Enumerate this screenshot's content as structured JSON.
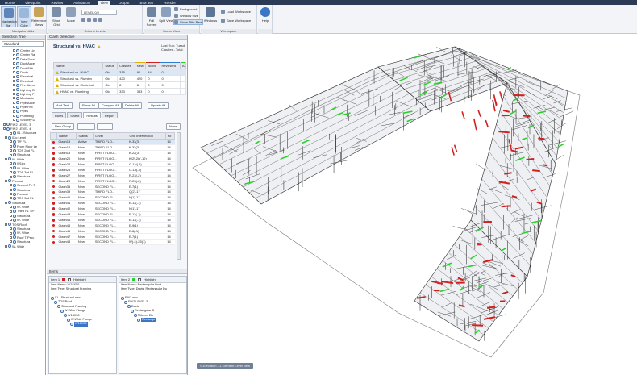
{
  "menu": [
    "Home",
    "Viewpoint",
    "Review",
    "Animation",
    "View",
    "Output",
    "BIM 360",
    "Render"
  ],
  "menu_active": "View",
  "ribbon": {
    "groups": [
      "Navigation Aids",
      "Grids & Levels",
      "Scene View",
      "Workspace"
    ],
    "buttons": {
      "navigation_bar": "Navigation Bar",
      "view_cube": "View Cube",
      "reference_views": "Reference Views",
      "show_grid": "Show Grid",
      "mode": "Mode",
      "full_screen": "Full Screen",
      "split_view": "Split View",
      "windows": "Windows",
      "help": "Help"
    },
    "grid_combo": "LEVEL 0/0",
    "scene_small": [
      "Background",
      "Window Size",
      "Show Title Bars"
    ],
    "workspace_small": [
      "Load Workspace",
      "Save Workspace"
    ]
  },
  "selection_tree": {
    "title": "Selection Tree",
    "combo": "Standard",
    "nodes": [
      "Center Lin",
      "Center Ra",
      "Data Devi",
      "Duct Acce",
      "Duct Fitti",
      "Ducts",
      "Electrical",
      "Electrical",
      "Fire Alarm",
      "Lighting D",
      "Lighting F",
      "Mechanic",
      "Pipe Acce",
      "Pipe Fitti",
      "Pipes",
      "Plumbing",
      "Security D",
      "FIN2 LEVEL 3",
      "FIN2 LEVEL 4",
      "01 - Structura",
      "03c Level",
      "T/F FL",
      "From Floor Le",
      "TOS 2nd FL",
      "Structura",
      "W- Wide",
      "W18x",
      "W- Wide",
      "TOS 3rd FL",
      "Structura",
      "Precast",
      "Second FL T",
      "Structura",
      "Precast",
      "TOS 3rd FL",
      "Structura",
      "W- Wide",
      "Third FL T/F",
      "Structura",
      "W- Wide",
      "TOS Roof",
      "Structura",
      "W- Wide",
      "Roof T/Proc",
      "Structura",
      "W- Wide"
    ]
  },
  "clash": {
    "panel_title": "Clash Detective",
    "test_name": "Structural vs. HVAC",
    "last_run": "Last Run: Tuesd",
    "clashes_total": "Clashes - Total:",
    "tests_headers": [
      "Name",
      "Status",
      "Clashes",
      "New",
      "Active",
      "Reviewed",
      "A"
    ],
    "tests": [
      {
        "name": "Structural vs. HVAC",
        "status": "Old",
        "clashes": "315",
        "new": "90",
        "active": "44",
        "reviewed": "0"
      },
      {
        "name": "Structural vs. Plumbin",
        "status": "Old",
        "clashes": "420",
        "new": "420",
        "active": "0",
        "reviewed": "0"
      },
      {
        "name": "Structural vs. Electrical",
        "status": "Old",
        "clashes": "8",
        "new": "8",
        "active": "0",
        "reviewed": "0"
      },
      {
        "name": "HVAC vs. Plumbing",
        "status": "Old",
        "clashes": "333",
        "new": "333",
        "active": "0",
        "reviewed": "0"
      }
    ],
    "buttons": {
      "add_test": "Add Test",
      "reset_all": "Reset All",
      "compact_all": "Compact All",
      "delete_all": "Delete All",
      "update_all": "Update All"
    },
    "tabs": [
      "Rules",
      "Select",
      "Results",
      "Report"
    ],
    "active_tab": "Results",
    "new_group": "New Group",
    "none_combo": "None",
    "results_headers": [
      "Name",
      "Status",
      "Level",
      "Grid Intersection",
      "Fo"
    ],
    "results": [
      {
        "name": "Clash15",
        "status": "Active",
        "level": "THIRD FLO...",
        "grid": "K-33(3)",
        "found": "14"
      },
      {
        "name": "Clash16",
        "status": "New",
        "level": "THIRD FLO...",
        "grid": "K-33(3)",
        "found": "14"
      },
      {
        "name": "Clash18",
        "status": "New",
        "level": "FIRST FLOO...",
        "grid": "K-22(3)",
        "found": "14"
      },
      {
        "name": "Clash20",
        "status": "New",
        "level": "FIRST FLOO...",
        "grid": "K(2)-26(-10)",
        "found": "14"
      },
      {
        "name": "Clash24",
        "status": "New",
        "level": "FIRST FLOO...",
        "grid": "G-1N(-2)",
        "found": "14"
      },
      {
        "name": "Clash26",
        "status": "New",
        "level": "FIRST FLOO...",
        "grid": "G-18(-3)",
        "found": "14"
      },
      {
        "name": "Clash27",
        "status": "New",
        "level": "FIRST FLOO...",
        "grid": "R-23(-2)",
        "found": "14"
      },
      {
        "name": "Clash28",
        "status": "New",
        "level": "FIRST FLOO...",
        "grid": "R-23(-2)",
        "found": "14"
      },
      {
        "name": "Clash35",
        "status": "New",
        "level": "SECOND FL...",
        "grid": "E-7(1)",
        "found": "14"
      },
      {
        "name": "Clash39",
        "status": "New",
        "level": "THIRD FLO...",
        "grid": "Q(2)-17",
        "found": "14"
      },
      {
        "name": "Clash40",
        "status": "New",
        "level": "SECOND FL...",
        "grid": "N(1)-17",
        "found": "14"
      },
      {
        "name": "Clash41",
        "status": "New",
        "level": "SECOND FL...",
        "grid": "E-13(-1)",
        "found": "14"
      },
      {
        "name": "Clash42",
        "status": "New",
        "level": "SECOND FL...",
        "grid": "N(1)-17",
        "found": "14"
      },
      {
        "name": "Clash43",
        "status": "New",
        "level": "SECOND FL...",
        "grid": "E-13(-1)",
        "found": "14"
      },
      {
        "name": "Clash44",
        "status": "New",
        "level": "SECOND FL...",
        "grid": "E-13(-1)",
        "found": "14"
      },
      {
        "name": "Clash45",
        "status": "New",
        "level": "SECOND FL...",
        "grid": "E-9(1)",
        "found": "14"
      },
      {
        "name": "Clash46",
        "status": "New",
        "level": "SECOND FL...",
        "grid": "E-8(-1)",
        "found": "14"
      },
      {
        "name": "Clash47",
        "status": "New",
        "level": "SECOND FL...",
        "grid": "E-7(1)",
        "found": "14"
      },
      {
        "name": "Clash48",
        "status": "New",
        "level": "SECOND FL...",
        "grid": "W(-4)-25(1)",
        "found": "14"
      }
    ]
  },
  "items": {
    "title": "Items",
    "item1": {
      "label": "Item 1",
      "highlight": "Highlight",
      "item_name": "Item Name: W18X50",
      "item_type": "Item Type: Structural Framing",
      "tree": [
        "01 - Structural.nwc",
        "TOS Roof",
        "Structural Framing",
        "W-Wide Flange",
        "W18X50",
        "W-Wide Flange",
        "W18X50"
      ]
    },
    "item2": {
      "label": "Item 2",
      "highlight": "Highlight",
      "item_name": "Item Name: Rectangular Duct",
      "item_type": "Item Type: Ducts: Rectangular Du",
      "tree": [
        "FIN2.nwc",
        "FIN2 LEVEL 3",
        "Ducts",
        "Rectangular D",
        "Mitered Elb",
        "Rectangu"
      ]
    }
  },
  "viewport": {
    "status": "S-Elevation - 1-Element Level view"
  },
  "colors": {
    "clash_red": "#d02020",
    "pipe_green": "#2bd12b",
    "accent_blue": "#3a76c4"
  }
}
